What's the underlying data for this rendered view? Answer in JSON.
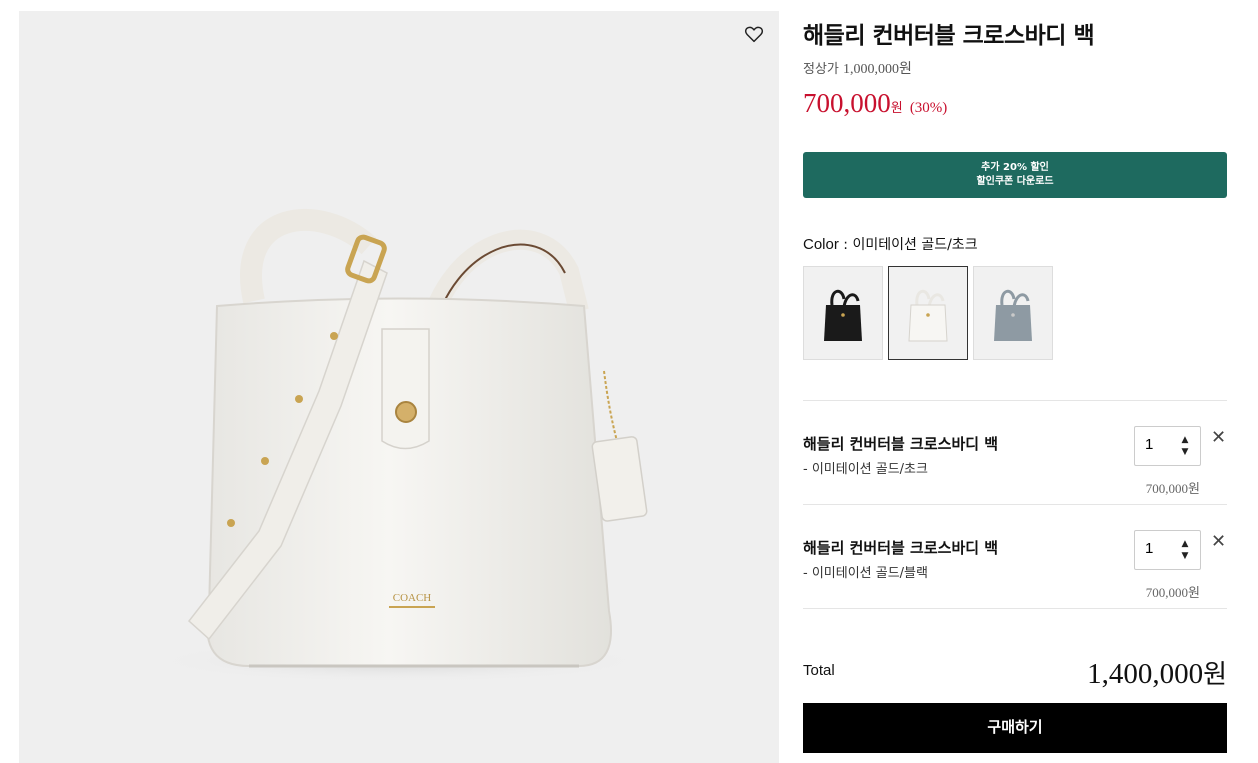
{
  "product": {
    "title": "해들리 컨버터블 크로스바디 백",
    "regular_label": "정상가",
    "regular_price": "1,000,000원",
    "sale_price": "700,000",
    "sale_won": "원",
    "discount_rate": "(30%)"
  },
  "coupon": {
    "line1": "추가 20% 할인",
    "line2": "할인쿠폰 다운로드"
  },
  "color": {
    "label": "Color",
    "separator": " : ",
    "selected": "이미테이션 골드/초크",
    "swatches": [
      {
        "name": "black",
        "color": "#1a1a1a"
      },
      {
        "name": "chalk",
        "color": "#f2f0eb"
      },
      {
        "name": "grey-blue",
        "color": "#8e9aa3"
      }
    ]
  },
  "options": [
    {
      "name": "해들리 컨버터블 크로스바디 백",
      "variant": "- 이미테이션 골드/초크",
      "quantity": "1",
      "price": "700,000",
      "won": "원"
    },
    {
      "name": "해들리 컨버터블 크로스바디 백",
      "variant": "- 이미테이션 골드/블랙",
      "quantity": "1",
      "price": "700,000",
      "won": "원"
    }
  ],
  "total": {
    "label": "Total",
    "value": "1,400,000",
    "won": "원"
  },
  "buy_label": "구매하기",
  "icons": {
    "wishlist": "heart-outline-icon",
    "remove": "close-icon",
    "qty_up": "caret-up-icon",
    "qty_down": "caret-down-icon"
  },
  "colors": {
    "sale": "#c8102e",
    "coupon_bg": "#1e6a5f",
    "buy_bg": "#000000",
    "image_bg": "#efefef"
  }
}
